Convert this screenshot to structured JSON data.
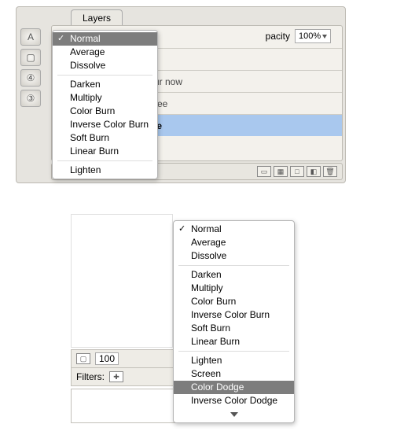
{
  "top": {
    "tab_label": "Layers",
    "opacity_label": "pacity",
    "opacity_value": "100%",
    "rows": {
      "r2": "ur now",
      "r3": "ree",
      "r4": "le"
    }
  },
  "menu1": {
    "g1": {
      "a": "Normal",
      "b": "Average",
      "c": "Dissolve"
    },
    "g2": {
      "a": "Darken",
      "b": "Multiply",
      "c": "Color Burn",
      "d": "Inverse Color Burn",
      "e": "Soft Burn",
      "f": "Linear Burn"
    },
    "g3": {
      "a": "Lighten"
    }
  },
  "bot": {
    "hundred": "100",
    "filters_label": "Filters:"
  },
  "menu2": {
    "g1": {
      "a": "Normal",
      "b": "Average",
      "c": "Dissolve"
    },
    "g2": {
      "a": "Darken",
      "b": "Multiply",
      "c": "Color Burn",
      "d": "Inverse Color Burn",
      "e": "Soft Burn",
      "f": "Linear Burn"
    },
    "g3": {
      "a": "Lighten",
      "b": "Screen",
      "c": "Color Dodge",
      "d": "Inverse Color Dodge"
    }
  }
}
